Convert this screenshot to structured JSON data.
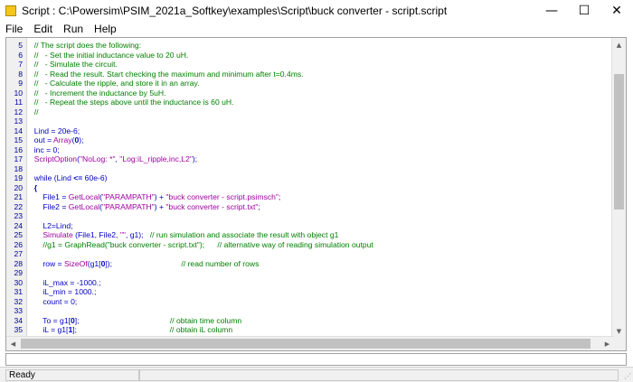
{
  "window": {
    "title": "Script : C:\\Powersim\\PSIM_2021a_Softkey\\examples\\Script\\buck converter - script.script",
    "minimize": "—",
    "maximize": "☐",
    "close": "✕"
  },
  "menu": [
    "File",
    "Edit",
    "Run",
    "Help"
  ],
  "colors": {
    "comment": "#008000",
    "code": "#0000c0",
    "string": "#a000a0",
    "line_number": "#0000a0"
  },
  "editor": {
    "lines": [
      {
        "n": "5",
        "tokens": [
          {
            "t": "  // The script does the following:",
            "c": "comment"
          }
        ]
      },
      {
        "n": "6",
        "tokens": [
          {
            "t": "  //   - Set the initial inductance value to 20 uH.",
            "c": "comment"
          }
        ]
      },
      {
        "n": "7",
        "tokens": [
          {
            "t": "  //   - Simulate the circuit.",
            "c": "comment"
          }
        ]
      },
      {
        "n": "8",
        "tokens": [
          {
            "t": "  //   - Read the result. Start checking the maximum and minimum after t=0.4ms.",
            "c": "comment"
          }
        ]
      },
      {
        "n": "9",
        "tokens": [
          {
            "t": "  //   - Calculate the ripple, and store it in an array.",
            "c": "comment"
          }
        ]
      },
      {
        "n": "10",
        "tokens": [
          {
            "t": "  //   - Increment the inductance by 5uH.",
            "c": "comment"
          }
        ]
      },
      {
        "n": "11",
        "tokens": [
          {
            "t": "  //   - Repeat the steps above until the inductance is 60 uH.",
            "c": "comment"
          }
        ]
      },
      {
        "n": "12",
        "tokens": [
          {
            "t": "  //",
            "c": "comment"
          }
        ]
      },
      {
        "n": "13",
        "tokens": []
      },
      {
        "n": "14",
        "tokens": [
          {
            "t": "  Lind = 20e-6;",
            "c": "ident"
          }
        ]
      },
      {
        "n": "15",
        "tokens": [
          {
            "t": "  out = ",
            "c": "ident"
          },
          {
            "t": "Array",
            "c": "func"
          },
          {
            "t": "(",
            "c": "ident"
          },
          {
            "t": "0",
            "c": "bold"
          },
          {
            "t": ");",
            "c": "ident"
          }
        ]
      },
      {
        "n": "16",
        "tokens": [
          {
            "t": "  inc = 0;",
            "c": "ident"
          }
        ]
      },
      {
        "n": "17",
        "tokens": [
          {
            "t": "  ",
            "c": "ident"
          },
          {
            "t": "ScriptOption",
            "c": "func"
          },
          {
            "t": "(",
            "c": "ident"
          },
          {
            "t": "\"NoLog: *\"",
            "c": "string"
          },
          {
            "t": ", ",
            "c": "ident"
          },
          {
            "t": "\"Log:iL_ripple,inc,L2\"",
            "c": "string"
          },
          {
            "t": ");",
            "c": "ident"
          }
        ]
      },
      {
        "n": "18",
        "tokens": []
      },
      {
        "n": "19",
        "tokens": [
          {
            "t": "  while (Lind ",
            "c": "ident"
          },
          {
            "t": "<=",
            "c": "bold"
          },
          {
            "t": " 60e-6)",
            "c": "ident"
          }
        ]
      },
      {
        "n": "20",
        "tokens": [
          {
            "t": "  {",
            "c": "bold"
          }
        ]
      },
      {
        "n": "21",
        "tokens": [
          {
            "t": "      File1 = ",
            "c": "ident"
          },
          {
            "t": "GetLocal",
            "c": "func"
          },
          {
            "t": "(",
            "c": "ident"
          },
          {
            "t": "\"PARAMPATH\"",
            "c": "string"
          },
          {
            "t": ") + ",
            "c": "ident"
          },
          {
            "t": "\"buck converter - script.psimsch\"",
            "c": "string"
          },
          {
            "t": ";",
            "c": "ident"
          }
        ]
      },
      {
        "n": "22",
        "tokens": [
          {
            "t": "      File2 = ",
            "c": "ident"
          },
          {
            "t": "GetLocal",
            "c": "func"
          },
          {
            "t": "(",
            "c": "ident"
          },
          {
            "t": "\"PARAMPATH\"",
            "c": "string"
          },
          {
            "t": ") + ",
            "c": "ident"
          },
          {
            "t": "\"buck converter - script.txt\"",
            "c": "string"
          },
          {
            "t": ";",
            "c": "ident"
          }
        ]
      },
      {
        "n": "23",
        "tokens": []
      },
      {
        "n": "24",
        "tokens": [
          {
            "t": "      L2=Lind;",
            "c": "ident"
          }
        ]
      },
      {
        "n": "25",
        "tokens": [
          {
            "t": "      ",
            "c": "ident"
          },
          {
            "t": "Simulate",
            "c": "func"
          },
          {
            "t": " (File1, File2, ",
            "c": "ident"
          },
          {
            "t": "\"\"",
            "c": "string"
          },
          {
            "t": ", g1);   ",
            "c": "ident"
          },
          {
            "t": "// run simulation and associate the result with object g1",
            "c": "comment"
          }
        ]
      },
      {
        "n": "26",
        "tokens": [
          {
            "t": "      //g1 = GraphRead(\"buck converter - script.txt\");      // alternative way of reading simulation output",
            "c": "comment"
          }
        ]
      },
      {
        "n": "27",
        "tokens": []
      },
      {
        "n": "28",
        "tokens": [
          {
            "t": "      row = ",
            "c": "ident"
          },
          {
            "t": "SizeOf",
            "c": "func"
          },
          {
            "t": "(g1[",
            "c": "ident"
          },
          {
            "t": "0",
            "c": "bold"
          },
          {
            "t": "]);                                ",
            "c": "ident"
          },
          {
            "t": "// read number of rows",
            "c": "comment"
          }
        ]
      },
      {
        "n": "29",
        "tokens": []
      },
      {
        "n": "30",
        "tokens": [
          {
            "t": "      iL_max = -1000.;",
            "c": "ident"
          }
        ]
      },
      {
        "n": "31",
        "tokens": [
          {
            "t": "      iL_min = 1000.;",
            "c": "ident"
          }
        ]
      },
      {
        "n": "32",
        "tokens": [
          {
            "t": "      count = 0;",
            "c": "ident"
          }
        ]
      },
      {
        "n": "33",
        "tokens": []
      },
      {
        "n": "34",
        "tokens": [
          {
            "t": "      To = g1[",
            "c": "ident"
          },
          {
            "t": "0",
            "c": "bold"
          },
          {
            "t": "];                                          ",
            "c": "ident"
          },
          {
            "t": "// obtain time column",
            "c": "comment"
          }
        ]
      },
      {
        "n": "35",
        "tokens": [
          {
            "t": "      iL = g1[",
            "c": "ident"
          },
          {
            "t": "1",
            "c": "bold"
          },
          {
            "t": "];                                           ",
            "c": "ident"
          },
          {
            "t": "// obtain iL column",
            "c": "comment"
          }
        ]
      }
    ]
  },
  "status": {
    "text": "Ready"
  }
}
